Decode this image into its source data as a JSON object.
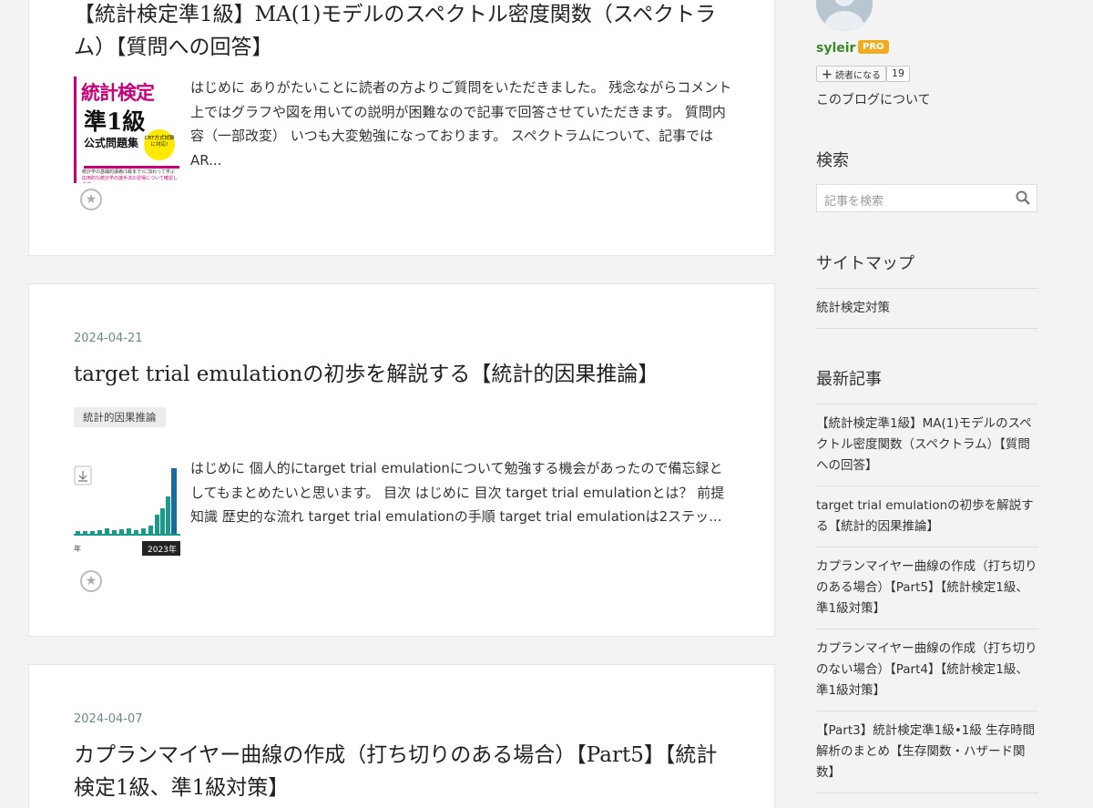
{
  "posts": [
    {
      "title": "【統計検定準1級】MA(1)モデルのスペクトル密度関数（スペクトラム）【質問への回答】",
      "excerpt": "はじめに ありがたいことに読者の方よりご質問をいただきました。 残念ながらコメント上ではグラフや図を用いての説明が困難なので記事で回答させていただきます。 質問内容（一部改変） いつも大変勉強になっております。 スペクトラムについて、記事ではAR...",
      "thumb": {
        "line1": "統計検定",
        "line2": "準1級",
        "line3": "公式問題集",
        "badge": "CBT方式試験に対応!",
        "blurb1": "統計学の基礎的講義(1級まで)に加わって学ぶ",
        "blurb2": "応用的な統計学の諸手法の習得について確認します"
      }
    },
    {
      "date": "2024-04-21",
      "title": "target trial emulationの初歩を解説する【統計的因果推論】",
      "tag": "統計的因果推論",
      "excerpt": "はじめに 個人的にtarget trial emulationについて勉強する機会があったので備忘録としてもまとめたいと思います。 目次 はじめに 目次 target trial emulationとは？ 前提知識 歴史的な流れ target trial emulationの手順 target trial emulationは2ステッ...",
      "thumb": {
        "tooltip": "2023年",
        "axis_label": "年"
      }
    },
    {
      "date": "2024-04-07",
      "title": "カプランマイヤー曲線の作成（打ち切りのある場合）【Part5】【統計検定1級、準1級対策】"
    }
  ],
  "sidebar": {
    "username": "syleir",
    "pro": "PRO",
    "follow_label": "読者になる",
    "follow_count": "19",
    "about": "このブログについて",
    "search_heading": "検索",
    "search_placeholder": "記事を検索",
    "sitemap_heading": "サイトマップ",
    "sitemap_items": [
      "統計検定対策"
    ],
    "recent_heading": "最新記事",
    "recent_items": [
      "【統計検定準1級】MA(1)モデルのスペクトル密度関数（スペクトラム）【質問への回答】",
      "target trial emulationの初歩を解説する【統計的因果推論】",
      "カプランマイヤー曲線の作成（打ち切りのある場合）【Part5】【統計検定1級、準1級対策】",
      "カプランマイヤー曲線の作成（打ち切りのない場合）【Part4】【統計検定1級、準1級対策】",
      "【Part3】統計検定準1級•1級 生存時間解析のまとめ【生存関数・ハザード関数】"
    ]
  },
  "colors": {
    "link_green": "#3a8a2a",
    "pro_orange": "#f0ac1e",
    "book_magenta": "#c8007a",
    "chart_teal": "#1a9a8a"
  }
}
